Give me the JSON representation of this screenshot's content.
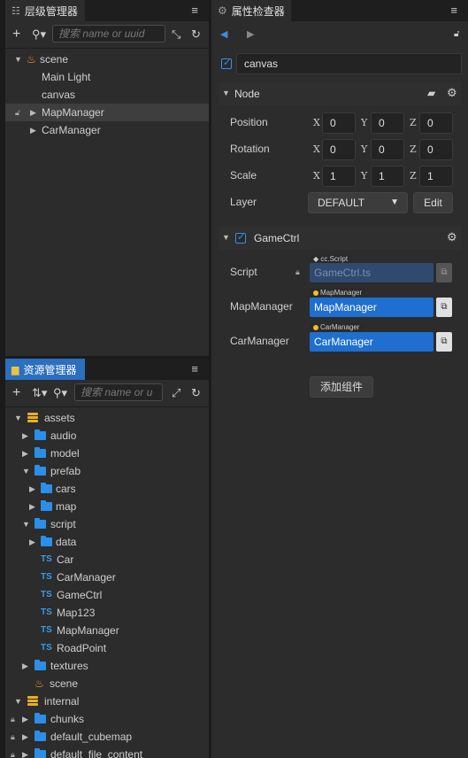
{
  "hierarchy": {
    "title": "层级管理器",
    "search_placeholder": "搜索 name or uuid",
    "tree": {
      "scene": "scene",
      "main_light": "Main Light",
      "canvas": "canvas",
      "map_manager": "MapManager",
      "car_manager": "CarManager"
    }
  },
  "assets": {
    "title": "资源管理器",
    "search_placeholder": "搜索 name or u",
    "tree": {
      "assets": "assets",
      "audio": "audio",
      "model": "model",
      "prefab": "prefab",
      "cars": "cars",
      "map": "map",
      "script": "script",
      "data": "data",
      "ts_label": "TS",
      "car": "Car",
      "car_manager": "CarManager",
      "game_ctrl": "GameCtrl",
      "map123": "Map123",
      "map_manager": "MapManager",
      "road_point": "RoadPoint",
      "textures": "textures",
      "scene": "scene",
      "internal": "internal",
      "chunks": "chunks",
      "default_cubemap": "default_cubemap",
      "default_file_content": "default_file_content"
    }
  },
  "inspector": {
    "title": "属性检查器",
    "node_name": "canvas",
    "node_section": "Node",
    "position_label": "Position",
    "rotation_label": "Rotation",
    "scale_label": "Scale",
    "layer_label": "Layer",
    "axis_x": "X",
    "axis_y": "Y",
    "axis_z": "Z",
    "position": {
      "x": "0",
      "y": "0",
      "z": "0"
    },
    "rotation": {
      "x": "0",
      "y": "0",
      "z": "0"
    },
    "scale": {
      "x": "1",
      "y": "1",
      "z": "1"
    },
    "layer_value": "DEFAULT",
    "edit_label": "Edit",
    "component_name": "GameCtrl",
    "script_label": "Script",
    "script_type_tag": "cc.Script",
    "script_value": "GameCtrl.ts",
    "map_manager_label": "MapManager",
    "map_manager_tag": "MapManager",
    "map_manager_value": "MapManager",
    "car_manager_label": "CarManager",
    "car_manager_tag": "CarManager",
    "car_manager_value": "CarManager",
    "add_component": "添加组件"
  },
  "colors": {
    "accent": "#2b7bd6",
    "folder": "#2b8ee8",
    "assets_db": "#e8b020"
  }
}
